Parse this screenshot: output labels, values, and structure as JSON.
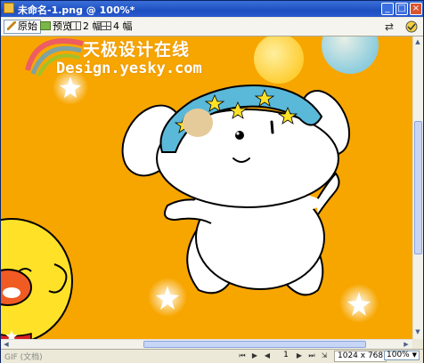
{
  "window": {
    "title": "未命名-1.png @ 100%*",
    "minimize_glyph": "_",
    "maximize_glyph": "□",
    "close_glyph": "×"
  },
  "toolbar": {
    "tabs": [
      {
        "label": "原始",
        "icon": "pencil-icon"
      },
      {
        "label": "预览",
        "icon": "preview-icon"
      },
      {
        "label": "2 幅",
        "icon": "two-up-icon"
      },
      {
        "label": "4 幅",
        "icon": "four-up-icon"
      }
    ],
    "right_icons": [
      "rotate-icon",
      "web-icon"
    ]
  },
  "watermark": {
    "line1": "天极设计在线",
    "line2": "Design.yesky.com"
  },
  "statusbar": {
    "format": "GIF (文档)",
    "frame": "1",
    "dimensions": "1024 x 768",
    "zoom": "100%"
  },
  "colors": {
    "canvas_background": "#f7a600",
    "title_bar": "#1d4fc0",
    "bandana": "#5ab8d8"
  }
}
